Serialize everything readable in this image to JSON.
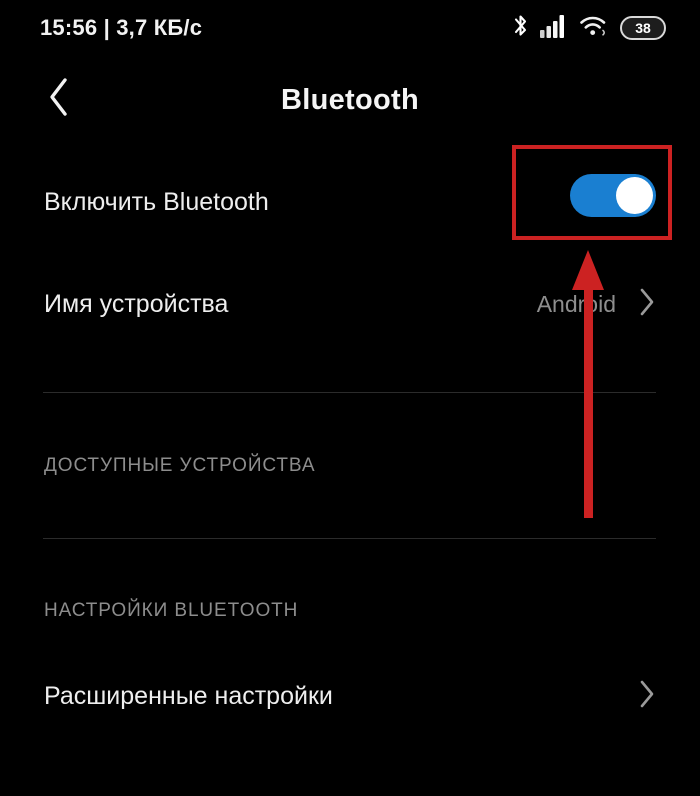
{
  "status_bar": {
    "time_and_rate": "15:56 | 3,7 КБ/с",
    "icons": [
      {
        "name": "bluetooth-icon",
        "label": "Bluetooth"
      },
      {
        "name": "cellular-signal-icon",
        "label": "Сигнал сети"
      },
      {
        "name": "wifi-icon",
        "label": "Wi-Fi"
      },
      {
        "name": "battery-icon",
        "label": "Батарея"
      }
    ],
    "battery_level": "38"
  },
  "app_bar": {
    "title": "Bluetooth",
    "back_icon": "chevron-left-icon"
  },
  "rows": {
    "bluetooth_toggle": {
      "label": "Включить Bluetooth",
      "toggle_state": "on"
    },
    "device_name": {
      "label": "Имя устройства",
      "value": "Android",
      "chevron_icon": "chevron-right-icon"
    },
    "advanced_settings": {
      "label": "Расширенные настройки",
      "chevron_icon": "chevron-right-icon"
    }
  },
  "sections": {
    "available_devices": "ДОСТУПНЫЕ УСТРОЙСТВА",
    "bluetooth_settings": "НАСТРОЙКИ BLUETOOTH"
  },
  "annotations": {
    "highlight_box": {
      "name": "red-highlight-box",
      "color": "#cc2222"
    },
    "pointer_arrow": {
      "name": "red-arrow-up",
      "color": "#cc2222",
      "direction": "up"
    }
  },
  "colors": {
    "background": "#000000",
    "toggle_on": "#1a7fd1",
    "toggle_knob": "#ffffff",
    "primary_text": "#eeeeee",
    "secondary_text": "#8e8e8e",
    "divider": "#2b2b2b",
    "annotation": "#cc2222"
  }
}
